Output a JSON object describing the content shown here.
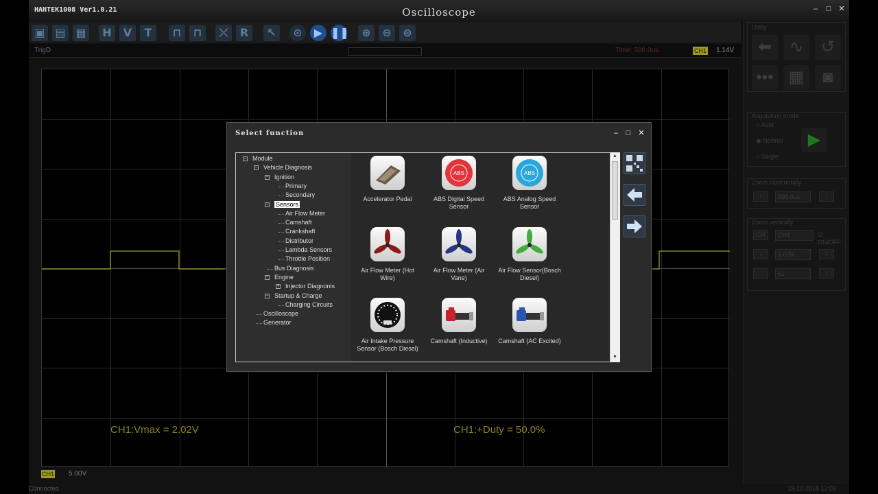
{
  "app": {
    "name": "HANTEK1008 Ver1.0.21",
    "title": "Oscilloscope",
    "window_buttons": [
      "–",
      "□",
      "✕"
    ]
  },
  "toolbar": {
    "buttons": [
      {
        "name": "open-icon",
        "glyph": "▣"
      },
      {
        "name": "save-icon",
        "glyph": "▤"
      },
      {
        "name": "print-icon",
        "glyph": "▦"
      },
      {
        "name": "h-cursor-icon",
        "glyph": "H"
      },
      {
        "name": "v-cursor-icon",
        "glyph": "V"
      },
      {
        "name": "t-cursor-icon",
        "glyph": "T"
      },
      {
        "name": "measure-icon",
        "glyph": "⊓"
      },
      {
        "name": "math-icon",
        "glyph": "⊓"
      },
      {
        "name": "xy-icon",
        "glyph": "⤬"
      },
      {
        "name": "reference-icon",
        "glyph": "R"
      },
      {
        "name": "cursor-icon",
        "glyph": "↖"
      },
      {
        "name": "auto-icon",
        "glyph": "⊙"
      },
      {
        "name": "run-icon",
        "glyph": "▶"
      },
      {
        "name": "pause-icon",
        "glyph": "❚❚"
      },
      {
        "name": "zoom-in-icon",
        "glyph": "⊕"
      },
      {
        "name": "zoom-out-icon",
        "glyph": "⊖"
      },
      {
        "name": "zoom-fit-icon",
        "glyph": "⊜"
      }
    ]
  },
  "status": {
    "trigger": "TrigD",
    "time": "Time: 500.0us",
    "channel": "CH1",
    "level": "1.14V"
  },
  "scope": {
    "vmax": "CH1:Vmax = 2.02V",
    "duty": "CH1:+Duty = 50.0%",
    "wave_color": "#8a8620",
    "channel": "CH1",
    "volts_div": "5.00V"
  },
  "footer": {
    "status": "Connected",
    "datetime": "19-10-2018 12:03"
  },
  "right_panel": {
    "utility_title": "Utility",
    "acquisition_title": "Acquisition mode",
    "acq_modes": [
      "Auto",
      "Normal",
      "Single"
    ],
    "zoom_h_title": "Zoom Horizontally",
    "zoom_h_value": "500.0us",
    "zoom_v_title": "Zoom vertically",
    "ch_label": "CH",
    "ch_value": "CH1",
    "onoff": "ON/OFF",
    "volt_value": "5.00V",
    "probe_value": "x1"
  },
  "dialog": {
    "title": "Select function",
    "buttons": [
      "–",
      "□",
      "✕"
    ],
    "tree": [
      {
        "label": "Module",
        "level": 0,
        "box": "−"
      },
      {
        "label": "Vehicle Diagnosis",
        "level": 1,
        "box": "−"
      },
      {
        "label": "Ignition",
        "level": 2,
        "box": "−"
      },
      {
        "label": "Primary",
        "level": 3,
        "box": ""
      },
      {
        "label": "Secondary",
        "level": 3,
        "box": ""
      },
      {
        "label": "Sensors",
        "level": 2,
        "box": "−",
        "selected": true
      },
      {
        "label": "Air Flow Meter",
        "level": 3,
        "box": ""
      },
      {
        "label": "Camshaft",
        "level": 3,
        "box": ""
      },
      {
        "label": "Crankshaft",
        "level": 3,
        "box": ""
      },
      {
        "label": "Distributor",
        "level": 3,
        "box": ""
      },
      {
        "label": "Lambda Sensors",
        "level": 3,
        "box": ""
      },
      {
        "label": "Throttle Position",
        "level": 3,
        "box": ""
      },
      {
        "label": "Bus Diagnosis",
        "level": 2,
        "box": ""
      },
      {
        "label": "Engine",
        "level": 2,
        "box": "−"
      },
      {
        "label": "Injector Diagnonis",
        "level": 3,
        "box": "+"
      },
      {
        "label": "Startup & Charge",
        "level": 2,
        "box": "−"
      },
      {
        "label": "Charging Circuits",
        "level": 3,
        "box": ""
      },
      {
        "label": "Oscilloscope",
        "level": 1,
        "box": ""
      },
      {
        "label": "Generator",
        "level": 1,
        "box": ""
      }
    ],
    "items": [
      {
        "label": "Accelerator Pedal",
        "icon": "pedal-icon"
      },
      {
        "label": "ABS Digital Speed Sensor",
        "icon": "abs-digital-icon",
        "badge": "ABS"
      },
      {
        "label": "ABS Analog Speed Sensor",
        "icon": "abs-analog-icon",
        "badge": "ABS"
      },
      {
        "label": "Air Flow Meter (Hot Wire)",
        "icon": "propeller-red-icon",
        "color": "#8b1a1a"
      },
      {
        "label": "Air Flow Meter (Air Vane)",
        "icon": "propeller-navy-icon",
        "color": "#283583"
      },
      {
        "label": "Air Flow Sensor(Bosch Diesel)",
        "icon": "propeller-green-icon",
        "color": "#3fae3f"
      },
      {
        "label": "Air Intake Pressure Sensor (Bosch Diesel)",
        "icon": "gauge-icon"
      },
      {
        "label": "Camshaft (Inductive)",
        "icon": "camshaft-red-icon",
        "color": "#c8232b"
      },
      {
        "label": "Camshaft (AC Excited)",
        "icon": "camshaft-blue-icon",
        "color": "#2a56b0"
      }
    ],
    "side_buttons": [
      "qr-code-icon",
      "back-arrow-icon",
      "forward-arrow-icon"
    ]
  }
}
